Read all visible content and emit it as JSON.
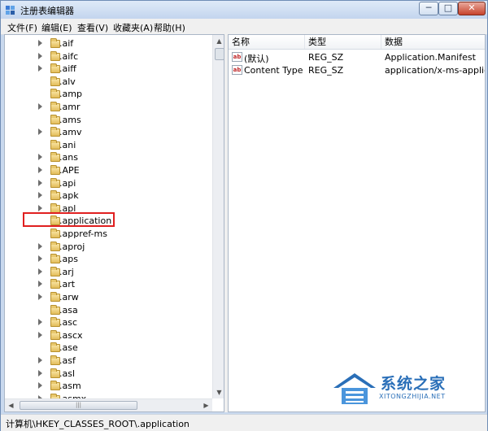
{
  "window": {
    "title": "注册表编辑器",
    "buttons": {
      "minimize": "─",
      "maximize": "□",
      "close": "✕"
    }
  },
  "menu": [
    "文件(F)",
    "编辑(E)",
    "查看(V)",
    "收藏夹(A)",
    "帮助(H)"
  ],
  "tree": {
    "items": [
      {
        "label": ".aif",
        "expandable": true
      },
      {
        "label": ".aifc",
        "expandable": true
      },
      {
        "label": ".aiff",
        "expandable": true
      },
      {
        "label": ".alv",
        "expandable": false
      },
      {
        "label": ".amp",
        "expandable": false
      },
      {
        "label": ".amr",
        "expandable": true
      },
      {
        "label": ".ams",
        "expandable": false
      },
      {
        "label": ".amv",
        "expandable": true
      },
      {
        "label": ".ani",
        "expandable": false
      },
      {
        "label": ".ans",
        "expandable": true
      },
      {
        "label": ".APE",
        "expandable": true
      },
      {
        "label": ".api",
        "expandable": true
      },
      {
        "label": ".apk",
        "expandable": true
      },
      {
        "label": ".apl",
        "expandable": true
      },
      {
        "label": ".application",
        "expandable": false,
        "selected": true
      },
      {
        "label": ".appref-ms",
        "expandable": false
      },
      {
        "label": ".aproj",
        "expandable": true
      },
      {
        "label": ".aps",
        "expandable": true
      },
      {
        "label": ".arj",
        "expandable": true
      },
      {
        "label": ".art",
        "expandable": true
      },
      {
        "label": ".arw",
        "expandable": true
      },
      {
        "label": ".asa",
        "expandable": false
      },
      {
        "label": ".asc",
        "expandable": true
      },
      {
        "label": ".ascx",
        "expandable": true
      },
      {
        "label": ".ase",
        "expandable": false
      },
      {
        "label": ".asf",
        "expandable": true
      },
      {
        "label": ".asl",
        "expandable": true
      },
      {
        "label": ".asm",
        "expandable": true
      },
      {
        "label": ".asmx",
        "expandable": true
      }
    ],
    "hscroll_grip": "|||"
  },
  "list": {
    "columns": [
      "名称",
      "类型",
      "数据"
    ],
    "rows": [
      {
        "name": "(默认)",
        "type": "REG_SZ",
        "data": "Application.Manifest"
      },
      {
        "name": "Content Type",
        "type": "REG_SZ",
        "data": "application/x-ms-application"
      }
    ]
  },
  "status": "计算机\\HKEY_CLASSES_ROOT\\.application",
  "watermark": {
    "title": "系统之家",
    "subtitle": "XITONGZHIJIA.NET"
  }
}
